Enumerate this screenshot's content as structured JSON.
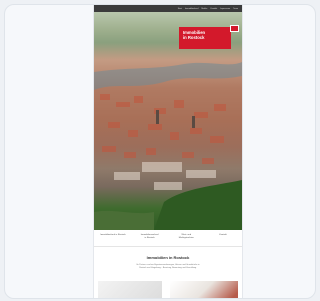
{
  "nav": {
    "items": [
      "Start",
      "Immobilienkauf",
      "Makler",
      "Kontakt",
      "Impressum",
      "Team"
    ]
  },
  "brand": {
    "line1": "Immobilien",
    "line2": "in Rostock",
    "accent": "#d3192b"
  },
  "tabs": [
    {
      "label": "Immobilienkauf in Rostock",
      "sub": ""
    },
    {
      "label": "Immobilienverkauf",
      "sub": "in Rostock"
    },
    {
      "label": "Wert- und",
      "sub": "Marktgutachten"
    },
    {
      "label": "Kontakt",
      "sub": ""
    }
  ],
  "section": {
    "title": "Immobilien in Rostock",
    "intro_line1": "Ihr Partner rund um Eigentumswohnungen, Häuser und Grundstücke in",
    "intro_line2": "Rostock und Umgebung – Beratung, Bewertung und Vermittlung."
  }
}
